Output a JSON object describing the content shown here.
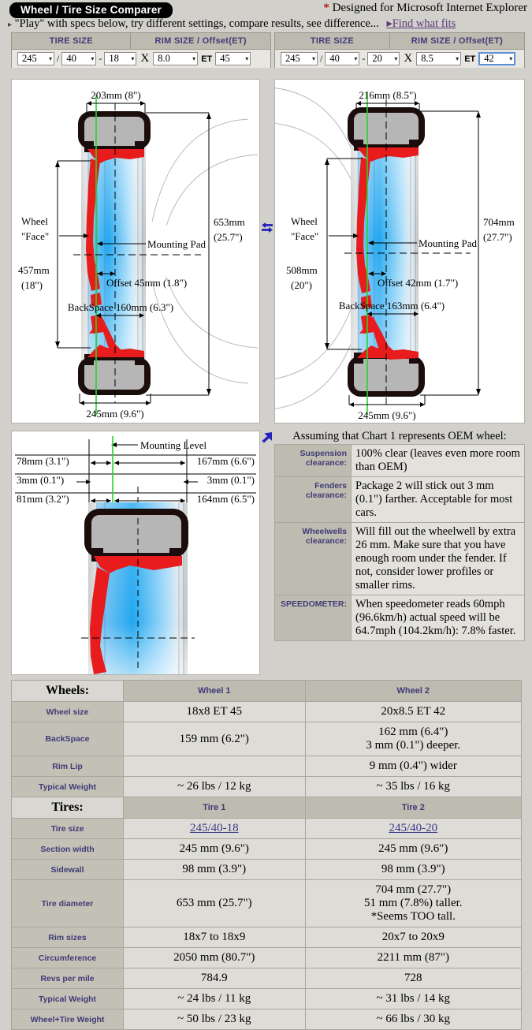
{
  "header": {
    "title": "Wheel / Tire Size Comparer",
    "designed_asterisk": "*",
    "designed_for": "Designed for Microsoft Internet Explorer",
    "play_bullet": "▸",
    "play_text": "\"Play\" with specs below, try different settings, compare results, see difference...",
    "find_fits_bullet": "▸",
    "find_fits": "Find what fits"
  },
  "selectors": {
    "col_tire_size": "TIRE SIZE",
    "col_rim_size": "RIM SIZE / Offset(ET)",
    "slash": "/",
    "dash": "-",
    "x": "X",
    "et": "ET",
    "arrow": "▾",
    "panel1": {
      "width": "245",
      "aspect": "40",
      "diameter": "18",
      "rim_width": "8.0",
      "offset": "45"
    },
    "panel2": {
      "width": "245",
      "aspect": "40",
      "diameter": "20",
      "rim_width": "8.5",
      "offset": "42"
    }
  },
  "diagram1": {
    "rim_width_dim": "203mm (8\")",
    "tire_diameter_dim_l1": "653mm",
    "tire_diameter_dim_l2": "(25.7\")",
    "wheel_face_l1": "Wheel",
    "wheel_face_l2": "\"Face\"",
    "backspace_dim": "BackSpace 160mm (6.3\")",
    "mounting_pad": "Mounting Pad",
    "rim_diameter_l1": "457mm",
    "rim_diameter_l2": "(18\")",
    "offset_dim": "Offset 45mm (1.8\")",
    "section_width_dim": "245mm (9.6\")"
  },
  "diagram2": {
    "rim_width_dim": "216mm (8.5\")",
    "tire_diameter_dim_l1": "704mm",
    "tire_diameter_dim_l2": "(27.7\")",
    "wheel_face_l1": "Wheel",
    "wheel_face_l2": "\"Face\"",
    "backspace_dim": "BackSpace 163mm (6.4\")",
    "mounting_pad": "Mounting Pad",
    "rim_diameter_l1": "508mm",
    "rim_diameter_l2": "(20\")",
    "offset_dim": "Offset 42mm (1.7\")",
    "section_width_dim": "245mm (9.6\")"
  },
  "diagram3": {
    "mounting_level": "Mounting Level",
    "left_1": "78mm (3.1\")",
    "left_2": "3mm (0.1\")",
    "left_3": "81mm (3.2\")",
    "right_1": "167mm (6.6\")",
    "right_2": "3mm (0.1\")",
    "right_3": "164mm (6.5\")"
  },
  "comparison": {
    "title": "Assuming that Chart 1 represents OEM wheel:",
    "rows": [
      {
        "label_l1": "Suspension",
        "label_l2": "clearance:",
        "value": "100% clear (leaves even more room than OEM)"
      },
      {
        "label_l1": "Fenders",
        "label_l2": "clearance:",
        "value": "Package 2 will stick out 3 mm (0.1\") farther. Acceptable for most cars."
      },
      {
        "label_l1": "Wheelwells",
        "label_l2": "clearance:",
        "value": "Will fill out the wheelwell by extra 26 mm. Make sure that you have enough room under the fender. If not, consider lower profiles or smaller rims."
      },
      {
        "label_l1": "SPEEDOMETER:",
        "label_l2": "",
        "value": "When speedometer reads 60mph (96.6km/h) actual speed will be 64.7mph (104.2km/h): 7.8% faster."
      }
    ]
  },
  "spec_table": {
    "wheels_section": "Wheels:",
    "wheel1_head": "Wheel 1",
    "wheel2_head": "Wheel 2",
    "tires_section": "Tires:",
    "tire1_head": "Tire 1",
    "tire2_head": "Tire 2",
    "wheel_rows": [
      {
        "label": "Wheel size",
        "v1": "18x8 ET 45",
        "v2": "20x8.5 ET 42"
      },
      {
        "label": "BackSpace",
        "v1": "159 mm (6.2\")",
        "v2": "162 mm (6.4\")\n3 mm (0.1\") deeper."
      },
      {
        "label": "Rim Lip",
        "v1": "",
        "v2": "9 mm (0.4\") wider"
      },
      {
        "label": "Typical Weight",
        "v1": "~ 26 lbs / 12 kg",
        "v2": "~ 35 lbs / 16 kg"
      }
    ],
    "tire_rows": [
      {
        "label": "Tire size",
        "v1": "245/40-18",
        "v2": "245/40-20",
        "link": true
      },
      {
        "label": "Section width",
        "v1": "245 mm (9.6\")",
        "v2": "245 mm (9.6\")"
      },
      {
        "label": "Sidewall",
        "v1": "98 mm (3.9\")",
        "v2": "98 mm (3.9\")"
      },
      {
        "label": "Tire diameter",
        "v1": "653 mm (25.7\")",
        "v2": "704 mm (27.7\")\n51 mm (7.8%) taller.\n*Seems TOO tall."
      },
      {
        "label": "Rim sizes",
        "v1": "18x7 to 18x9",
        "v2": "20x7 to 20x9"
      },
      {
        "label": "Circumference",
        "v1": "2050 mm (80.7\")",
        "v2": "2211 mm (87\")"
      },
      {
        "label": "Revs per mile",
        "v1": "784.9",
        "v2": "728"
      },
      {
        "label": "Typical Weight",
        "v1": "~ 24 lbs / 11 kg",
        "v2": "~ 31 lbs / 14 kg"
      },
      {
        "label": "Wheel+Tire Weight",
        "v1": "~ 50 lbs / 23 kg",
        "v2": "~ 66 lbs / 30 kg"
      }
    ]
  },
  "icons": {
    "swap": "swap-arrows-icon",
    "down_left": "arrow-down-left-icon"
  },
  "colors": {
    "accent_label": "#3f3a76",
    "link": "#3a3a8a",
    "asterisk": "#b02020",
    "page_bg": "#d2d0cb",
    "rim_red": "#e81c1c",
    "tire_black": "#1c0d0d",
    "tire_fill": "#b6b6b6"
  }
}
